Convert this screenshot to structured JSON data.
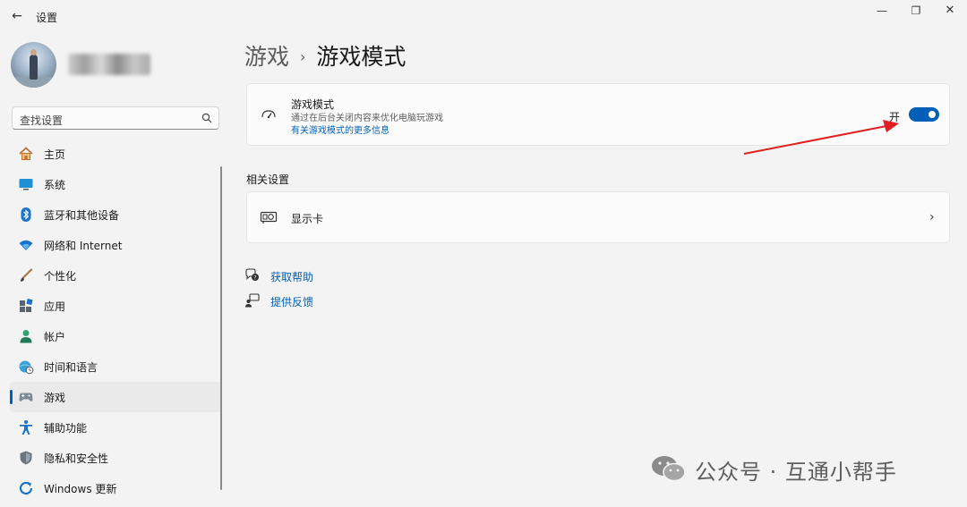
{
  "window": {
    "back_icon": "back-arrow-icon",
    "title": "设置",
    "controls": {
      "minimize": "—",
      "maximize": "❐",
      "close": "✕"
    }
  },
  "user": {
    "avatar_icon": "user-avatar-photo"
  },
  "search": {
    "placeholder": "查找设置",
    "icon": "search-icon"
  },
  "nav": {
    "items": [
      {
        "label": "主页",
        "icon": "home-icon"
      },
      {
        "label": "系统",
        "icon": "system-display-icon"
      },
      {
        "label": "蓝牙和其他设备",
        "icon": "bluetooth-icon"
      },
      {
        "label": "网络和 Internet",
        "icon": "wifi-icon"
      },
      {
        "label": "个性化",
        "icon": "brush-icon"
      },
      {
        "label": "应用",
        "icon": "apps-icon"
      },
      {
        "label": "帐户",
        "icon": "person-icon"
      },
      {
        "label": "时间和语言",
        "icon": "globe-clock-icon"
      },
      {
        "label": "游戏",
        "icon": "gamepad-icon",
        "selected": true
      },
      {
        "label": "辅助功能",
        "icon": "accessibility-icon"
      },
      {
        "label": "隐私和安全性",
        "icon": "shield-icon"
      },
      {
        "label": "Windows 更新",
        "icon": "windows-update-icon"
      }
    ]
  },
  "breadcrumb": {
    "parent": "游戏",
    "separator": "›",
    "current": "游戏模式"
  },
  "game_mode": {
    "title": "游戏模式",
    "description": "通过在后台关闭内容来优化电脑玩游戏",
    "link": "有关游戏模式的更多信息",
    "toggle_text": "开",
    "toggle_on": true,
    "icon": "game-mode-gauge-icon"
  },
  "related": {
    "title": "相关设置",
    "display_card": {
      "label": "显示卡",
      "icon": "graphics-card-icon",
      "chevron": "›"
    }
  },
  "help": [
    {
      "label": "获取帮助",
      "icon": "help-chat-icon"
    },
    {
      "label": "提供反馈",
      "icon": "feedback-icon"
    }
  ],
  "watermark": {
    "text": "公众号 · 互通小帮手",
    "icon": "wechat-logo-icon"
  },
  "colors": {
    "accent": "#005fb8",
    "background": "#f3f3f3",
    "card": "#fbfbfb",
    "arrow": "#e02020"
  }
}
